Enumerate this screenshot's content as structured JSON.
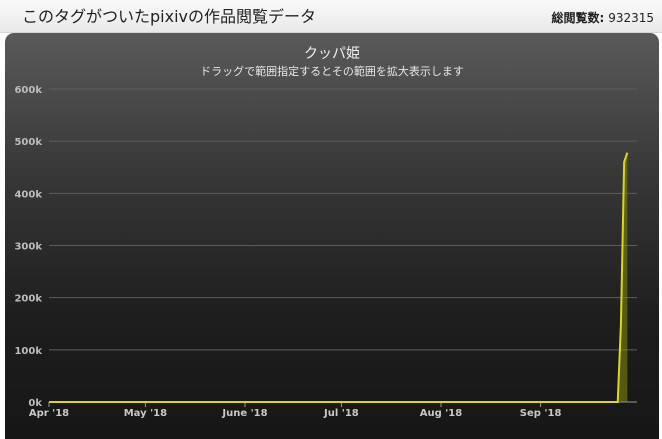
{
  "header": {
    "title": "このタグがついたpixivの作品閲覧データ",
    "total_label": "総閲覧数:",
    "total_value": "932315"
  },
  "chart_data": {
    "type": "area",
    "title": "クッパ姫",
    "subtitle": "ドラッグで範囲指定するとその範囲を拡大表示します",
    "x_tick_labels": [
      "Apr '18",
      "May '18",
      "June '18",
      "Jul '18",
      "Aug '18",
      "Sep '18"
    ],
    "y_tick_labels": [
      "0k",
      "100k",
      "200k",
      "300k",
      "400k",
      "500k",
      "600k"
    ],
    "ylim": [
      0,
      600000
    ],
    "xlim": [
      "2018-04-01",
      "2018-10-01"
    ],
    "grid": true,
    "series": [
      {
        "color": "#d8d820",
        "x": [
          "2018-04-01",
          "2018-09-25",
          "2018-09-26",
          "2018-09-27",
          "2018-09-28"
        ],
        "y": [
          0,
          0,
          150000,
          460000,
          478000
        ]
      }
    ]
  }
}
